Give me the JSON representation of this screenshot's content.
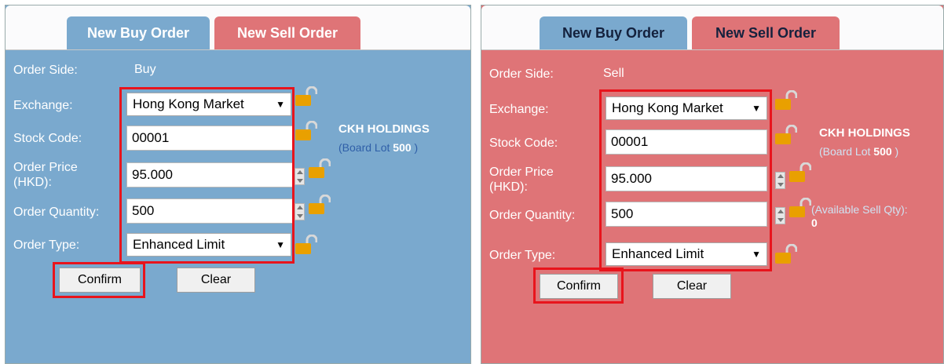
{
  "tabs": {
    "buy_label": "New Buy Order",
    "sell_label": "New Sell Order"
  },
  "labels": {
    "order_side": "Order Side:",
    "exchange": "Exchange:",
    "stock_code": "Stock Code:",
    "order_price_line1": "Order Price",
    "order_price_line2": "(HKD):",
    "order_quantity": "Order Quantity:",
    "order_type": "Order Type:"
  },
  "buy_panel": {
    "order_side": "Buy",
    "exchange": "Hong Kong Market",
    "stock_code": "00001",
    "order_price": "95.000",
    "order_quantity": "500",
    "order_type": "Enhanced Limit",
    "stock_name": "CKH HOLDINGS",
    "board_lot_open": "(",
    "board_lot_label": "Board Lot",
    "board_lot_value": "500",
    "board_lot_close": ")",
    "confirm": "Confirm",
    "clear": "Clear"
  },
  "sell_panel": {
    "order_side": "Sell",
    "exchange": "Hong Kong Market",
    "stock_code": "00001",
    "order_price": "95.000",
    "order_quantity": "500",
    "order_type": "Enhanced Limit",
    "stock_name": "CKH HOLDINGS",
    "board_lot_open": "(",
    "board_lot_label": "Board Lot",
    "board_lot_value": "500",
    "board_lot_close": ")",
    "available_sell_label": "(Available Sell Qty):",
    "available_sell_value": "0",
    "confirm": "Confirm",
    "clear": "Clear"
  },
  "icons": {
    "lock": "padlock-icon",
    "spinner": "stepper-arrows-icon",
    "dropdown": "dropdown-arrow-icon"
  },
  "colors": {
    "buy_panel": "#7aa9ce",
    "sell_panel": "#df7477",
    "highlight": "#e8141c",
    "lock_body": "#e9a000"
  }
}
